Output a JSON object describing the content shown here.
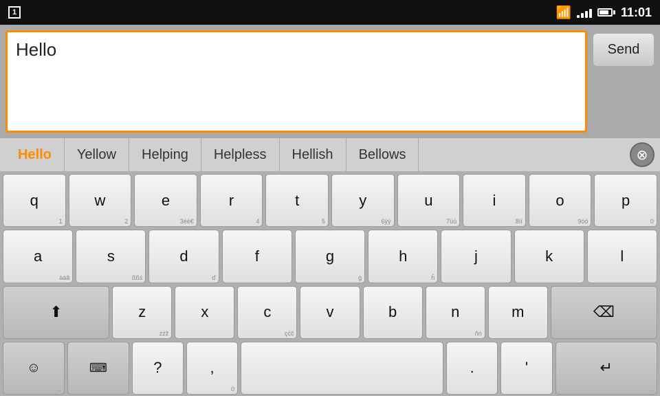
{
  "statusBar": {
    "notification": "1",
    "time": "11:01"
  },
  "inputArea": {
    "textValue": "Hello",
    "sendLabel": "Send"
  },
  "suggestions": [
    {
      "id": "s1",
      "text": "Hello",
      "active": true
    },
    {
      "id": "s2",
      "text": "Yellow",
      "active": false
    },
    {
      "id": "s3",
      "text": "Helping",
      "active": false
    },
    {
      "id": "s4",
      "text": "Helpless",
      "active": false
    },
    {
      "id": "s5",
      "text": "Hellish",
      "active": false
    },
    {
      "id": "s6",
      "text": "Bellows",
      "active": false
    }
  ],
  "keyboard": {
    "rows": [
      [
        {
          "main": "q",
          "sub": "1"
        },
        {
          "main": "w",
          "sub": "2"
        },
        {
          "main": "e",
          "sub": "3éè€"
        },
        {
          "main": "r",
          "sub": "4"
        },
        {
          "main": "t",
          "sub": "5"
        },
        {
          "main": "y",
          "sub": "6ÿý"
        },
        {
          "main": "u",
          "sub": "7üù"
        },
        {
          "main": "i",
          "sub": "8íï"
        },
        {
          "main": "o",
          "sub": "9öó"
        },
        {
          "main": "p",
          "sub": "0"
        }
      ],
      [
        {
          "main": "a",
          "sub": "àáã"
        },
        {
          "main": "s",
          "sub": "ßßś"
        },
        {
          "main": "d",
          "sub": "ď"
        },
        {
          "main": "f",
          "sub": ""
        },
        {
          "main": "g",
          "sub": "ġ"
        },
        {
          "main": "h",
          "sub": "ĥ"
        },
        {
          "main": "j",
          "sub": ""
        },
        {
          "main": "k",
          "sub": ""
        },
        {
          "main": "l",
          "sub": ""
        }
      ],
      [
        {
          "main": "⇧",
          "type": "shift"
        },
        {
          "main": "z",
          "sub": "żźž"
        },
        {
          "main": "x",
          "sub": ""
        },
        {
          "main": "c",
          "sub": "çćč"
        },
        {
          "main": "v",
          "sub": ""
        },
        {
          "main": "b",
          "sub": ""
        },
        {
          "main": "n",
          "sub": "ñń"
        },
        {
          "main": "m",
          "sub": ""
        },
        {
          "main": "⌫",
          "type": "backspace"
        }
      ],
      [
        {
          "main": "☺",
          "type": "emoji"
        },
        {
          "main": "⌨",
          "type": "keyboard-toggle"
        },
        {
          "main": "?",
          "sub": ""
        },
        {
          "main": ",",
          "sub": "0"
        },
        {
          "main": "",
          "type": "space"
        },
        {
          "main": ".",
          "sub": ""
        },
        {
          "main": "'",
          "sub": ""
        },
        {
          "main": "↵",
          "type": "enter"
        }
      ]
    ]
  }
}
